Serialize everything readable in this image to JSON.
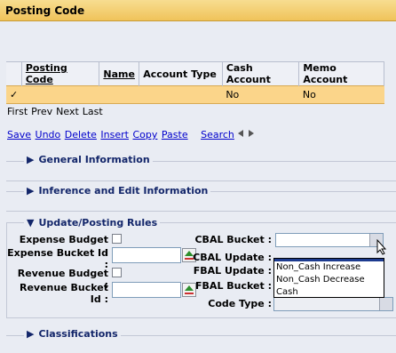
{
  "window": {
    "title": "Posting Code"
  },
  "grid": {
    "columns": [
      "Posting Code",
      "Name",
      "Account Type",
      "Cash Account",
      "Memo Account"
    ],
    "row": {
      "check": "✓",
      "posting_code": "",
      "name": "",
      "account_type": "",
      "cash_account": "No",
      "memo_account": "No"
    }
  },
  "pager": {
    "first": "First",
    "prev": "Prev",
    "next": "Next",
    "last": "Last"
  },
  "toolbar": {
    "save": "Save",
    "undo": "Undo",
    "delete": "Delete",
    "insert": "Insert",
    "copy": "Copy",
    "paste": "Paste",
    "search": "Search"
  },
  "sections": {
    "general": "General Information",
    "inference": "Inference and Edit Information",
    "update": "Update/Posting Rules",
    "classifications": "Classifications"
  },
  "form": {
    "expense_budget": "Expense Budget :",
    "expense_bucket_id": "Expense Bucket Id :",
    "revenue_budget": "Revenue Budget :",
    "revenue_bucket_id": "Revenue Bucket Id :",
    "cbal_bucket": "CBAL Bucket :",
    "cbal_update": "CBAL Update :",
    "fbal_update": "FBAL Update :",
    "fbal_bucket": "FBAL Bucket :",
    "code_type": "Code Type :"
  },
  "dropdown": {
    "options": [
      "Non_Cash Increase",
      "Non_Cash Decrease",
      "Cash"
    ]
  }
}
